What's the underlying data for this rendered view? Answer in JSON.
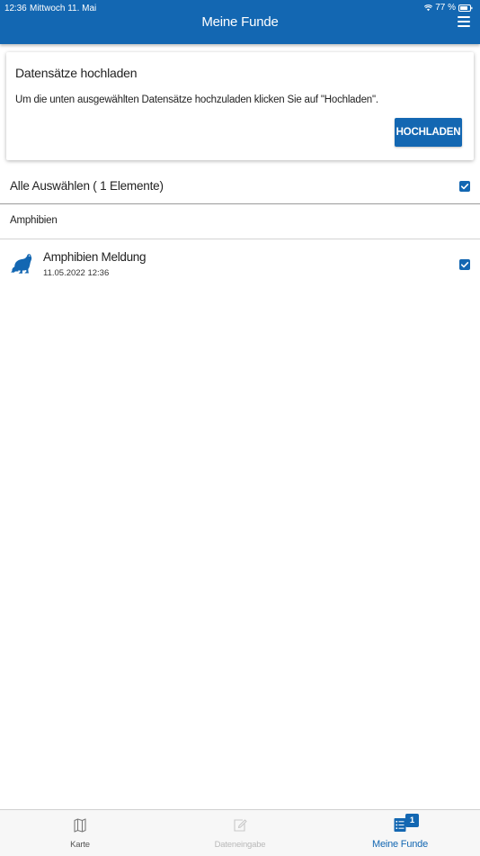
{
  "status_bar": {
    "time": "12:36",
    "date": "Mittwoch 11. Mai",
    "battery": "77 %"
  },
  "header": {
    "title": "Meine Funde",
    "menu_icon": "hamburger-menu-icon"
  },
  "upload_card": {
    "title": "Datensätze hochladen",
    "text": "Um die unten ausgewählten Datensätze hochzuladen klicken Sie auf \"Hochladen\".",
    "button_label": "HOCHLADEN"
  },
  "select_all": {
    "label": "Alle Auswählen ( 1 Elemente)",
    "checked": true
  },
  "category": {
    "label": "Amphibien"
  },
  "items": [
    {
      "icon": "frog-icon",
      "title": "Amphibien Meldung",
      "timestamp": "11.05.2022 12:36",
      "checked": true
    }
  ],
  "tabs": [
    {
      "label": "Karte",
      "icon": "map-icon",
      "state": "normal"
    },
    {
      "label": "Dateneingabe",
      "icon": "edit-icon",
      "state": "disabled"
    },
    {
      "label": "Meine Funde",
      "icon": "list-icon",
      "state": "active",
      "badge": "1"
    }
  ],
  "colors": {
    "primary": "#1367b2",
    "background": "#ffffff",
    "tabbar_background": "#f7f7f7"
  }
}
